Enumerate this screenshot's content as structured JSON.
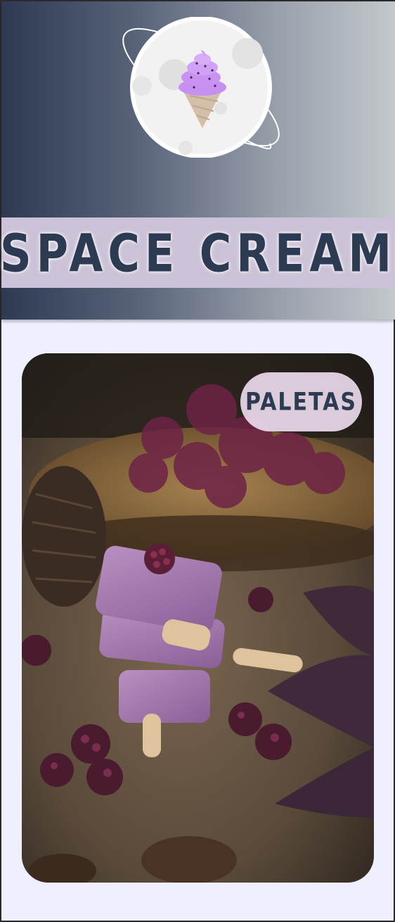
{
  "brand": {
    "title": "SPACE CREAM",
    "logo_icon": "ice-cream-planet-logo"
  },
  "product_card": {
    "badge_label": "PALETAS",
    "image_subject": "stacked purple blackberry popsicles"
  },
  "colors": {
    "header_gradient_start": "#2d3a52",
    "header_gradient_end": "#c3c8cc",
    "banner": "#cbc2d7",
    "title_text": "#2c3b52",
    "page_background": "#eff0ff",
    "badge_background": "#ecdaec"
  }
}
